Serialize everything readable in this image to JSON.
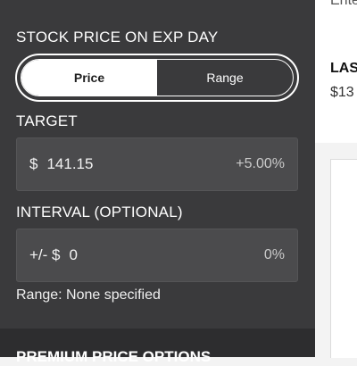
{
  "stock_price_section": {
    "title": "STOCK PRICE ON EXP DAY",
    "toggle": {
      "options": [
        "Price",
        "Range"
      ],
      "selected": "Price"
    }
  },
  "target": {
    "label": "TARGET",
    "prefix": "$",
    "value": "141.15",
    "percent": "+5.00%"
  },
  "interval": {
    "label": "INTERVAL (OPTIONAL)",
    "prefix": "+/- $",
    "value": "0",
    "percent": "0%"
  },
  "range_note": "Range: None specified",
  "premium_section": {
    "title": "PREMIUM PRICE OPTIONS"
  },
  "right_card": {
    "top_text": "Ente",
    "last_label": "LAS",
    "last_value": "$13"
  },
  "colors": {
    "panel_bg": "#3a3a3c",
    "field_bg": "#4b4b4d",
    "toggle_active_bg": "#ffffff",
    "page_bg": "#f3f3f3"
  }
}
